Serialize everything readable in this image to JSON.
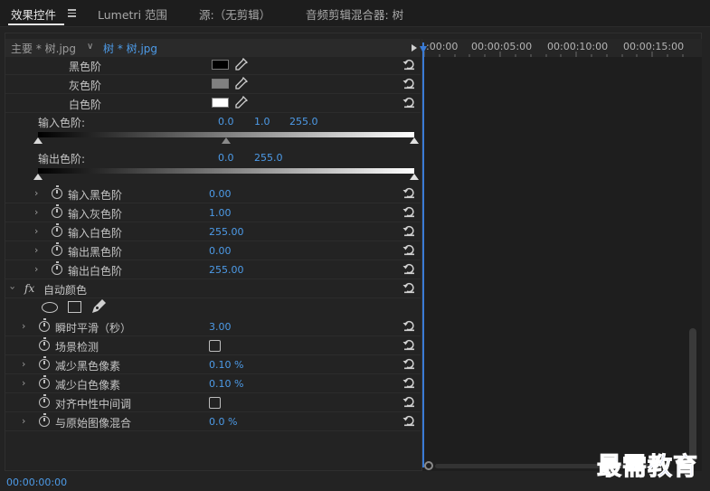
{
  "tabs": [
    {
      "label": "效果控件",
      "active": true
    },
    {
      "label": "Lumetri 范围",
      "active": false
    },
    {
      "label": "源:（无剪辑）",
      "active": false
    },
    {
      "label": "音频剪辑混合器: 树",
      "active": false
    }
  ],
  "clip_header": {
    "main_clip": "主要 * 树.jpg",
    "active_clip": "树 * 树.jpg"
  },
  "ruler": {
    "labels": [
      ":00:00",
      "00:00:05:00",
      "00:00:10:00",
      "00:00:15:00"
    ]
  },
  "swatch_rows": [
    {
      "label": "黑色阶",
      "color": "#000000"
    },
    {
      "label": "灰色阶",
      "color": "#808080"
    },
    {
      "label": "白色阶",
      "color": "#ffffff"
    }
  ],
  "input_levels": {
    "label": "输入色阶:",
    "values": [
      "0.0",
      "1.0",
      "255.0"
    ]
  },
  "output_levels": {
    "label": "输出色阶:",
    "values": [
      "0.0",
      "255.0"
    ]
  },
  "level_params": [
    {
      "label": "输入黑色阶",
      "value": "0.00"
    },
    {
      "label": "输入灰色阶",
      "value": "1.00"
    },
    {
      "label": "输入白色阶",
      "value": "255.00"
    },
    {
      "label": "输出黑色阶",
      "value": "0.00"
    },
    {
      "label": "输出白色阶",
      "value": "255.00"
    }
  ],
  "auto_color": {
    "fx": "fx",
    "title": "自动颜色"
  },
  "auto_params": [
    {
      "label": "瞬时平滑（秒）",
      "value": "3.00",
      "unit": "",
      "type": "value",
      "expandable": true
    },
    {
      "label": "场景检测",
      "value": "",
      "unit": "",
      "type": "checkbox",
      "expandable": false
    },
    {
      "label": "减少黑色像素",
      "value": "0.10",
      "unit": "%",
      "type": "value",
      "expandable": true
    },
    {
      "label": "减少白色像素",
      "value": "0.10",
      "unit": "%",
      "type": "value",
      "expandable": true
    },
    {
      "label": "对齐中性中间调",
      "value": "",
      "unit": "",
      "type": "checkbox",
      "expandable": false
    },
    {
      "label": "与原始图像混合",
      "value": "0.0",
      "unit": "%",
      "type": "value",
      "expandable": true
    }
  ],
  "timecode": "00:00:00:00",
  "watermark": "最需教育",
  "colors": {
    "accent": "#4d9be8",
    "playhead": "#3a7bd5",
    "watermark": "#2d4bd2"
  }
}
